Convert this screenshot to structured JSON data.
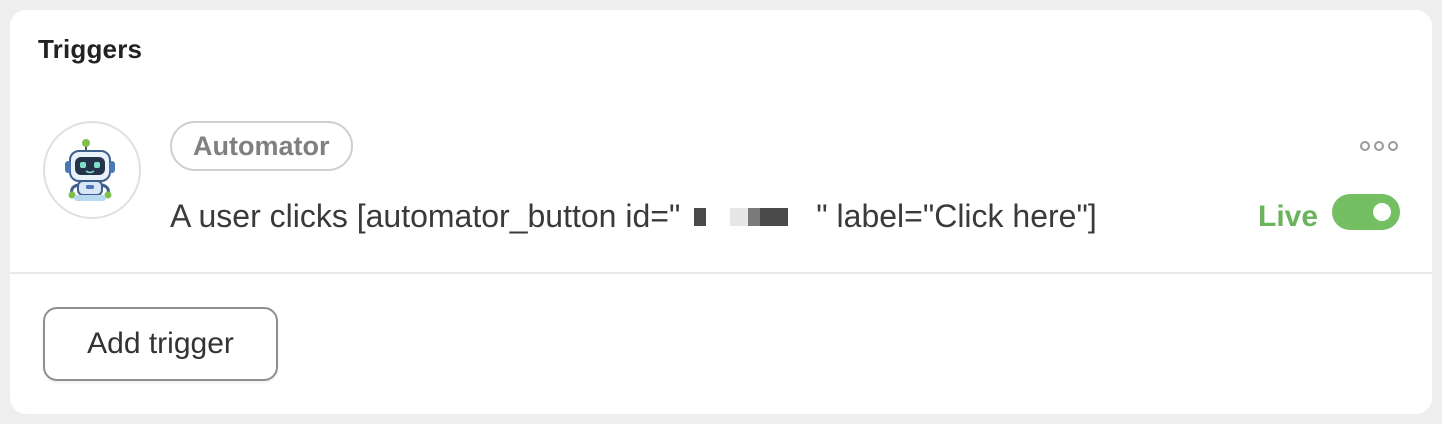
{
  "panel": {
    "title": "Triggers"
  },
  "trigger": {
    "integration": "Automator",
    "sentence_before": "A user clicks [automator_button id=\"",
    "sentence_after": "\" label=\"Click here\"]",
    "status_label": "Live",
    "status_on": true,
    "icons": {
      "avatar": "automator-robot-icon",
      "menu": "more-options-icon"
    }
  },
  "actions": {
    "add_label": "Add trigger"
  },
  "colors": {
    "live_green": "#6bb35d",
    "toggle_green": "#75bf63"
  }
}
